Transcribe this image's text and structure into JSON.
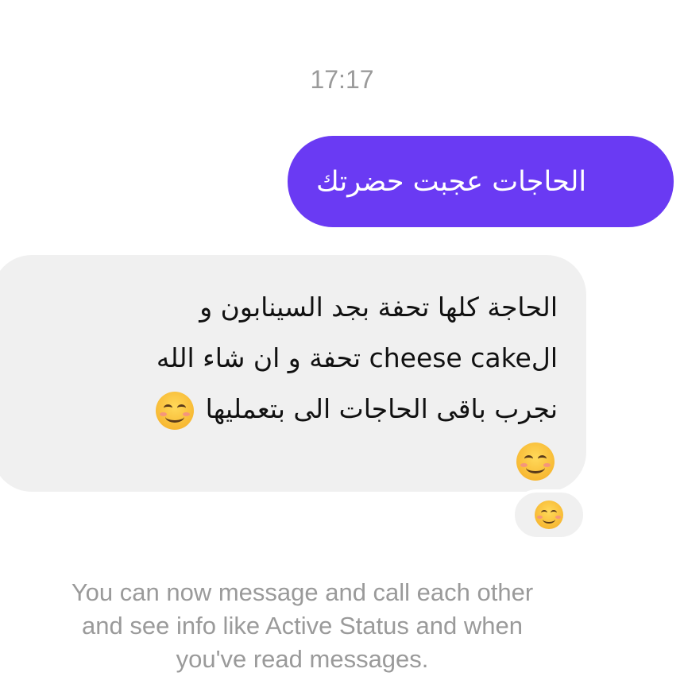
{
  "conversation": {
    "timestamp": "17:17",
    "sent_message": {
      "text": "الحاجات عجبت حضرتك",
      "bubble_color": "#6a3af3"
    },
    "received_message": {
      "lines": [
        "الحاجة كلها تحفة بجد السينابون و",
        "الcheese cake تحفة و ان شاء الله",
        "نجرب باقى الحاجات الى بتعمليها"
      ],
      "emoji": "smiling-face-with-smiling-eyes",
      "bubble_color": "#f0f0f0"
    },
    "reaction": {
      "emoji": "smiling-face"
    }
  },
  "footer": {
    "info_lines": [
      "You can now message and call each other",
      "and see info like Active Status and when",
      "you've read messages."
    ]
  }
}
